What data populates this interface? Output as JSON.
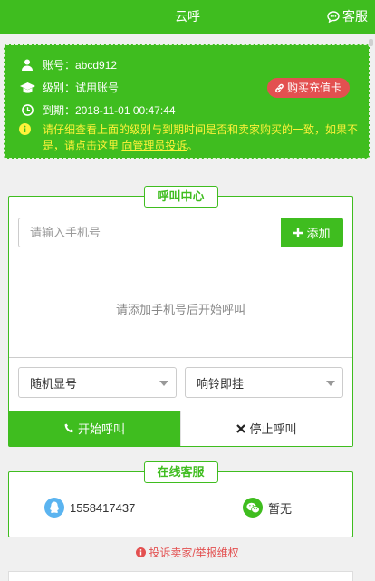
{
  "header": {
    "title": "云呼",
    "service_label": "客服"
  },
  "account": {
    "account_text": "账号：abcd912",
    "level_text": "级别：试用账号",
    "expiry_text": "到期：2018-11-01 00:47:44",
    "buy_button": "购买充值卡",
    "warning_text": "请仔细查看上面的级别与到期时间是否和卖家购买的一致，如果不是，请点击这里",
    "warning_link": "向管理员投诉",
    "warning_end": "。"
  },
  "call_center": {
    "legend": "呼叫中心",
    "phone_placeholder": "请输入手机号",
    "add_button": "添加",
    "empty_text": "请添加手机号后开始呼叫",
    "display_select": "随机显号",
    "mode_select": "响铃即挂",
    "start_button": "开始呼叫",
    "stop_button": "停止呼叫"
  },
  "online_service": {
    "legend": "在线客服",
    "qq_number": "1558417437",
    "wechat": "暂无"
  },
  "footer": {
    "complain_text": "投诉卖家/举报维权"
  },
  "colors": {
    "brand": "#3fbd1f",
    "warning": "#fff23a",
    "danger": "#e35050",
    "qq": "#5bb4f0",
    "wechat": "#3fbd1f"
  }
}
